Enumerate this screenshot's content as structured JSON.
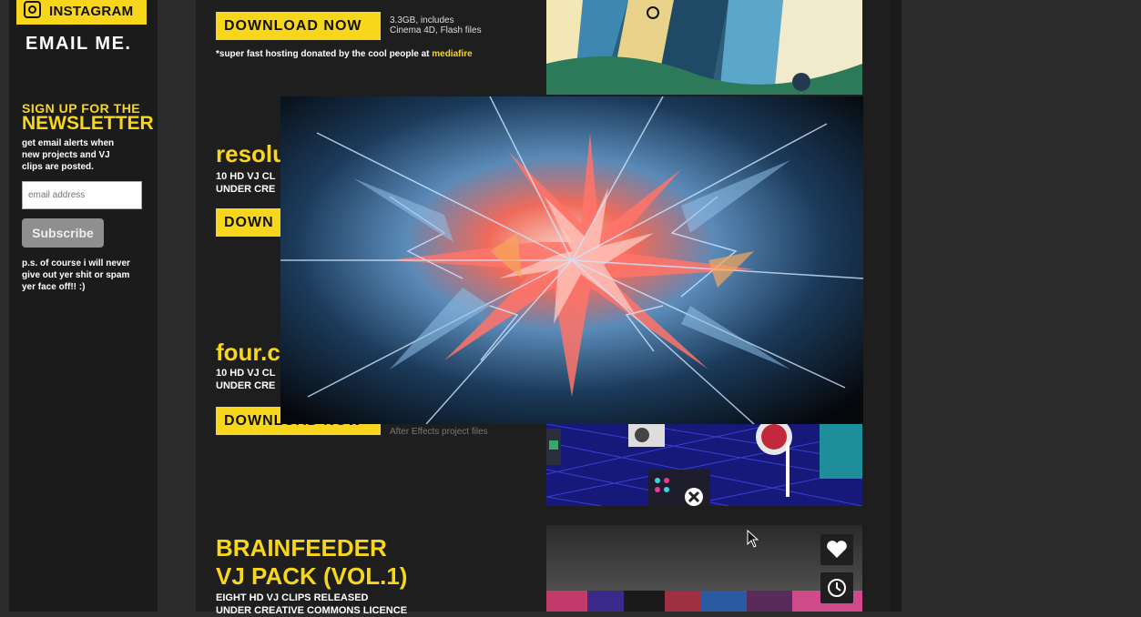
{
  "sidebar": {
    "instagram_label": "INSTAGRAM",
    "email_me": "EMAIL ME.",
    "newsletter_line1": "SIGN UP FOR THE",
    "newsletter_line2": "NEWSLETTER",
    "newsletter_desc": "get email alerts when new projects and VJ clips are posted.",
    "email_placeholder": "email address",
    "subscribe_label": "Subscribe",
    "ps_text": "p.s. of course i will never give out yer shit or spam yer face off!! :)"
  },
  "main": {
    "download_label": "DOWNLOAD NOW",
    "first_file_info_line1": "3.3GB, includes",
    "first_file_info_line2": "Cinema 4D, Flash files",
    "footnote_text": "*super fast hosting donated by the cool people at",
    "footnote_link": "mediafire",
    "section2_title": "resolu",
    "section2_sub_line1": "10 HD VJ CL",
    "section2_sub_line2": "UNDER CRE",
    "section2_btn": "DOWN",
    "section3_title": "four.c",
    "section3_sub_line1": "10 HD VJ CL",
    "section3_sub_line2": "UNDER CRE",
    "section3_file_info": "After Effects project files",
    "brainfeeder_title_line1": "BRAINFEEDER",
    "brainfeeder_title_line2": "VJ PACK (VOL.1)",
    "brainfeeder_sub_line1": "EIGHT HD VJ CLIPS RELEASED",
    "brainfeeder_sub_line2": "UNDER CREATIVE COMMONS LICENCE"
  },
  "colors": {
    "accent": "#f7d61b",
    "background": "#2b2b2b",
    "panel": "#1e1e1e"
  },
  "icons": {
    "instagram": "instagram-icon",
    "like": "heart-icon",
    "watch_later": "clock-icon",
    "cursor": "mouse-cursor-icon"
  }
}
